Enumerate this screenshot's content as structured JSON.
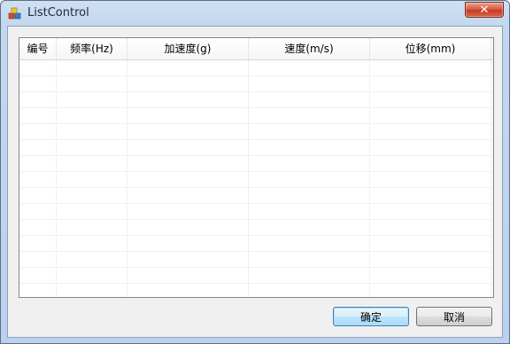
{
  "window": {
    "title": "ListControl",
    "icon": "app-blocks-icon",
    "close_glyph": "✕"
  },
  "list": {
    "columns": [
      "编号",
      "频率(Hz)",
      "加速度(g)",
      "速度(m/s)",
      "位移(mm)"
    ],
    "rows": []
  },
  "buttons": {
    "ok_label": "确定",
    "cancel_label": "取消"
  },
  "colors": {
    "frame": "#bcd2ec",
    "client": "#f0f0f0",
    "close": "#c63b22",
    "default_button": "#3c7fb1"
  }
}
